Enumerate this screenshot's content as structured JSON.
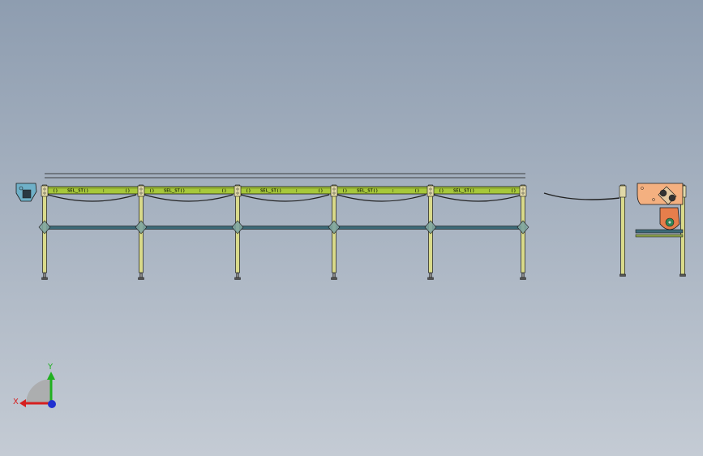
{
  "viewport": {
    "background_top": "#8e9db0",
    "background_bottom": "#c4cbd4"
  },
  "conveyor": {
    "segment_count": 5,
    "segment_label": "SEL_ST",
    "colors": {
      "beam": "#a7c83a",
      "leg": "#d9da8a",
      "brace": "#3c6a78",
      "outline": "#1a1a1a",
      "chain": "#222222",
      "bracket": "#e0d8a8"
    }
  },
  "drive_unit": {
    "motor_color": "#e67e4c",
    "gearbox_color": "#f4b080",
    "shaft_color": "#2e8b57"
  },
  "triad": {
    "x_label": "X",
    "y_label": "Y",
    "x_color": "#d62020",
    "y_color": "#20b020",
    "z_color": "#2030d0"
  }
}
